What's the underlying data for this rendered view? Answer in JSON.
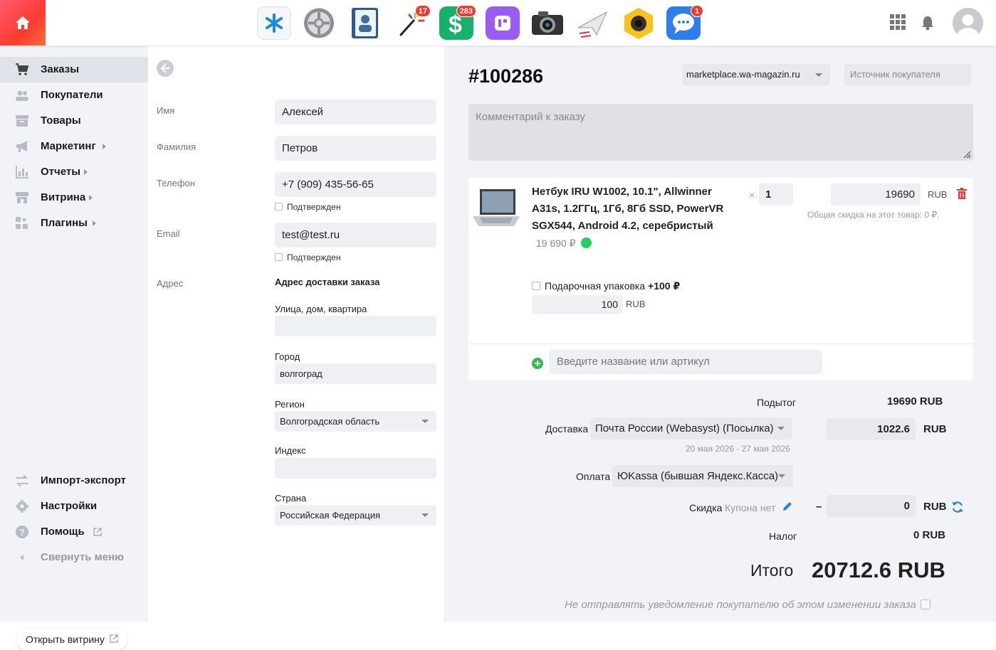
{
  "topbar": {
    "apps": [
      {
        "name": "shop-asterisk-app",
        "color": "#1e88e5",
        "badge": ""
      },
      {
        "name": "settings-gear-app",
        "color": "#8d8f94",
        "badge": ""
      },
      {
        "name": "contacts-app",
        "color": "#2e5c8a",
        "badge": ""
      },
      {
        "name": "crm-app",
        "color": "#222222",
        "badge": "17"
      },
      {
        "name": "money-app",
        "color": "#17b26a",
        "badge": "283"
      },
      {
        "name": "hub-app",
        "color": "#9b5cf6",
        "badge": ""
      },
      {
        "name": "camera-app",
        "color": "#333333",
        "badge": ""
      },
      {
        "name": "mailer-app",
        "color": "#d23b3b",
        "badge": ""
      },
      {
        "name": "webcam-app",
        "color": "#f7c21a",
        "badge": ""
      },
      {
        "name": "messenger-app",
        "color": "#2a7ef0",
        "badge": "1"
      }
    ]
  },
  "sidebar": {
    "items": [
      {
        "label": "Заказы"
      },
      {
        "label": "Покупатели"
      },
      {
        "label": "Товары"
      },
      {
        "label": "Маркетинг"
      },
      {
        "label": "Отчеты"
      },
      {
        "label": "Витрина"
      },
      {
        "label": "Плагины"
      }
    ],
    "bottom": [
      {
        "label": "Импорт-экспорт"
      },
      {
        "label": "Настройки"
      },
      {
        "label": "Помощь"
      },
      {
        "label": "Свернуть меню"
      }
    ],
    "open_storefront": "Открыть витрину"
  },
  "customer": {
    "first_name_label": "Имя",
    "first_name": "Алексей",
    "last_name_label": "Фамилия",
    "last_name": "Петров",
    "phone_label": "Телефон",
    "phone": "+7 (909) 435-56-65",
    "phone_confirmed": "Подтвержден",
    "email_label": "Email",
    "email": "test@test.ru",
    "email_confirmed": "Подтвержден",
    "address_label": "Адрес",
    "address_title": "Адрес доставки заказа",
    "street_label": "Улица, дом, квартира",
    "street": "",
    "city_label": "Город",
    "city": "волгоград",
    "region_label": "Регион",
    "region": "Волгоградская область",
    "zip_label": "Индекс",
    "zip": "",
    "country_label": "Страна",
    "country": "Российская Федерация"
  },
  "order": {
    "id": "#100286",
    "storefront": "marketplace.wa-magazin.ru",
    "source_placeholder": "Источник покупателя",
    "comment_placeholder": "Комментарий к заказу",
    "item": {
      "title": "Нетбук IRU W1002, 10.1\", Allwinner A31s, 1.2ГГц, 1Гб, 8Гб SSD, PowerVR SGX544, Android 4.2, серебристый",
      "price_text": "19 690 ₽",
      "qty_x": "×",
      "qty": "1",
      "price": "19690",
      "currency": "RUB",
      "discount_note": "Общая скидка на этот товар: 0 ₽.",
      "gift_label": "Подарочная упаковка",
      "gift_price": "+100 ₽",
      "gift_value": "100",
      "gift_currency": "RUB"
    },
    "add_placeholder": "Введите название или артикул",
    "totals": {
      "subtotal_label": "Подытог",
      "subtotal": "19690 RUB",
      "shipping_label": "Доставка",
      "shipping_method": "Почта России (Webasyst) (Посылка)",
      "shipping_dates": "20 мая 2026 - 27 мая 2026",
      "shipping_cost": "1022.6",
      "shipping_currency": "RUB",
      "payment_label": "Оплата",
      "payment_method": "ЮKassa (бывшая Яндекс.Касса)",
      "discount_label": "Скидка",
      "coupon_none": "Купона нет",
      "discount_minus": "–",
      "discount": "0",
      "discount_currency": "RUB",
      "tax_label": "Налог",
      "tax": "0 RUB",
      "total_label": "Итого",
      "total": "20712.6",
      "total_currency": "RUB"
    },
    "notify_label": "Не отправлять уведомление покупателю об этом изменении заказа"
  }
}
